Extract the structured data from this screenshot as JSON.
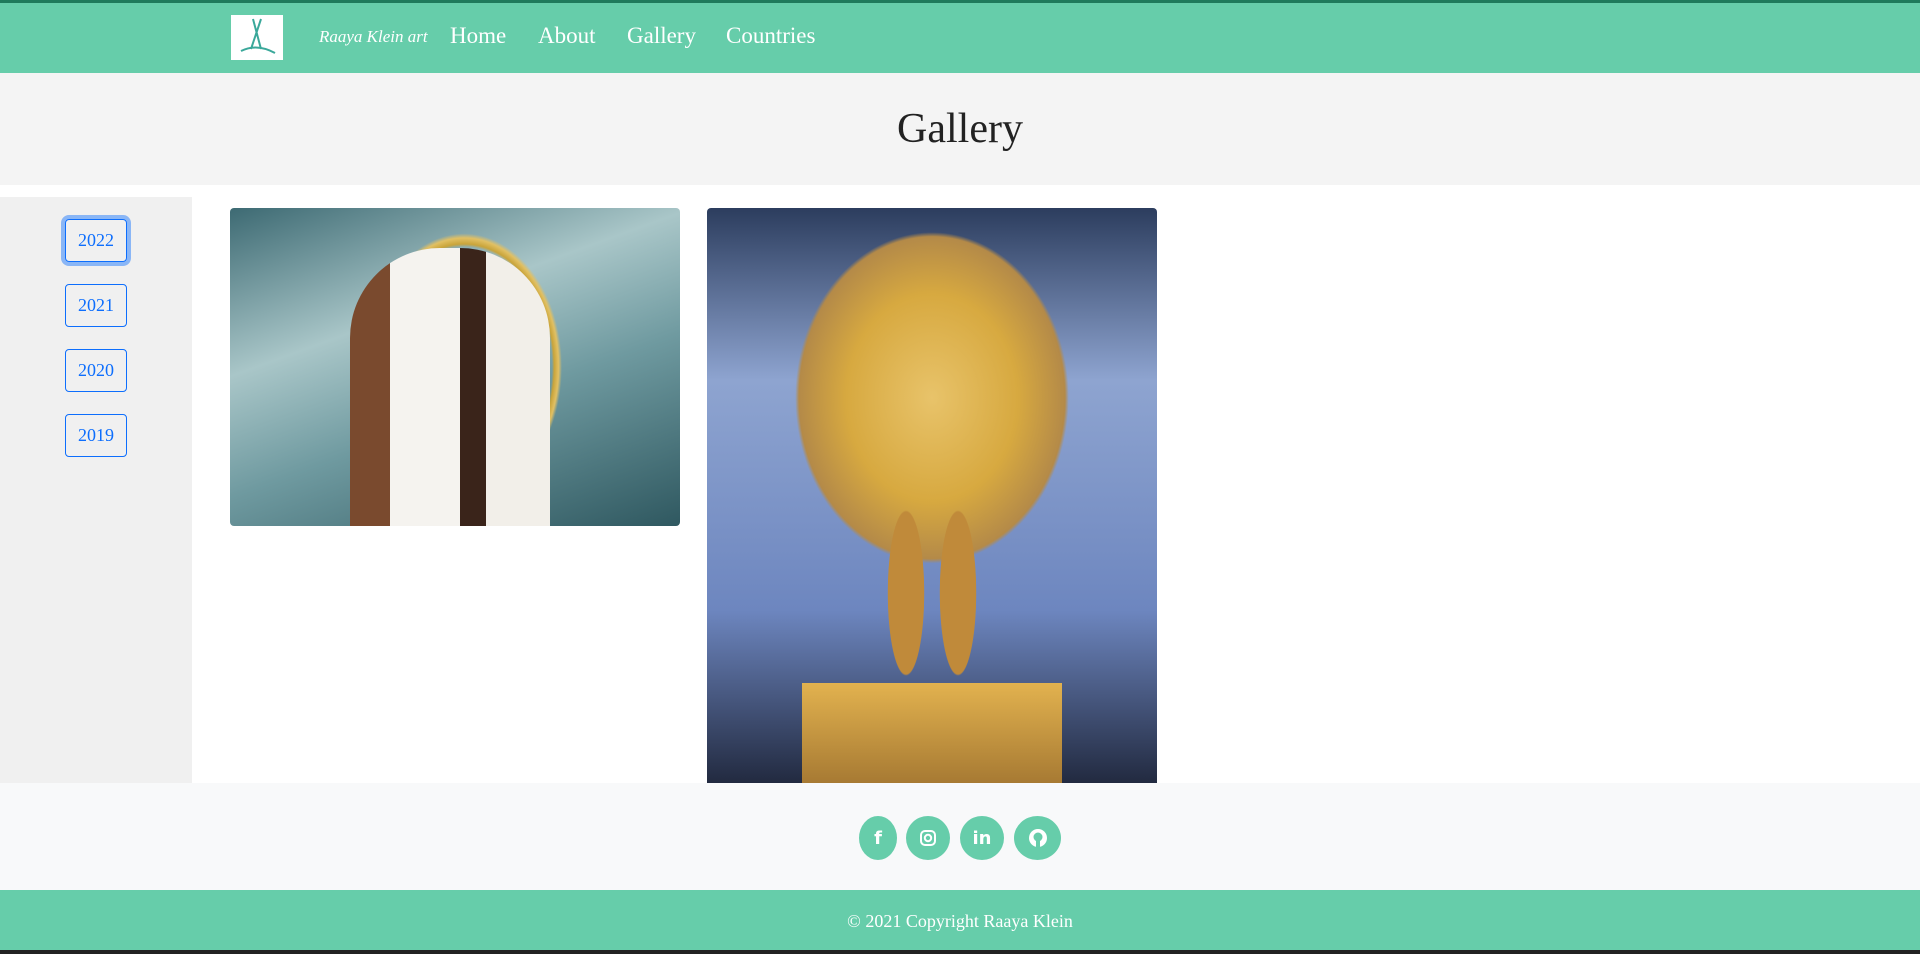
{
  "nav": {
    "brand": "Raaya Klein art",
    "links": [
      "Home",
      "About",
      "Gallery",
      "Countries"
    ]
  },
  "header": {
    "title": "Gallery"
  },
  "sidebar": {
    "years": [
      "2022",
      "2021",
      "2020",
      "2019"
    ],
    "active": "2022"
  },
  "gallery": {
    "images": [
      "couple-portrait-painting",
      "golden-peacock-painting"
    ]
  },
  "social": {
    "icons": [
      "facebook-icon",
      "instagram-icon",
      "linkedin-icon",
      "github-icon"
    ]
  },
  "footer": {
    "copyright": "© 2021 Copyright Raaya Klein"
  },
  "colors": {
    "brand": "#66cdaa",
    "button": "#0d6efd"
  }
}
